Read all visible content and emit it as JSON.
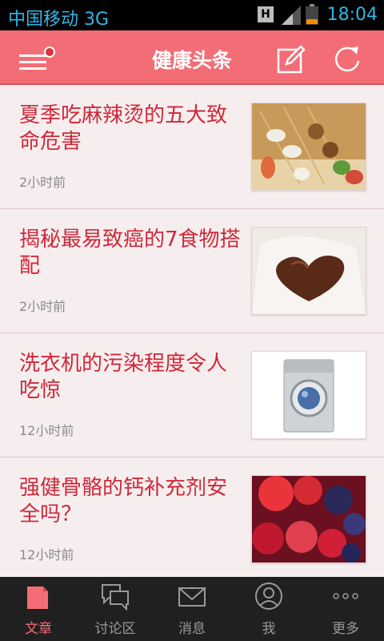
{
  "status_bar": {
    "carrier": "中国移动 3G",
    "time": "18:04",
    "h_label": "H"
  },
  "header": {
    "title": "健康头条"
  },
  "articles": [
    {
      "title": "夏季吃麻辣烫的五大致命危害",
      "time": "2小时前",
      "image": "skewers-photo"
    },
    {
      "title": "揭秘最易致癌的7食物搭配",
      "time": "2小时前",
      "image": "chocolate-heart-photo"
    },
    {
      "title": "洗衣机的污染程度令人吃惊",
      "time": "12小时前",
      "image": "washing-machine-photo"
    },
    {
      "title": "强健骨骼的钙补充剂安全吗？",
      "time": "12小时前",
      "image": "berries-photo"
    }
  ],
  "tabs": [
    {
      "label": "文章",
      "icon": "article-icon",
      "active": true
    },
    {
      "label": "讨论区",
      "icon": "discussion-icon",
      "active": false
    },
    {
      "label": "消息",
      "icon": "message-icon",
      "active": false
    },
    {
      "label": "我",
      "icon": "profile-icon",
      "active": false
    },
    {
      "label": "更多",
      "icon": "more-icon",
      "active": false
    }
  ],
  "colors": {
    "accent": "#f36d76",
    "title_text": "#d0283a",
    "status_text": "#33b5e5",
    "tabbar_bg": "#202020"
  }
}
